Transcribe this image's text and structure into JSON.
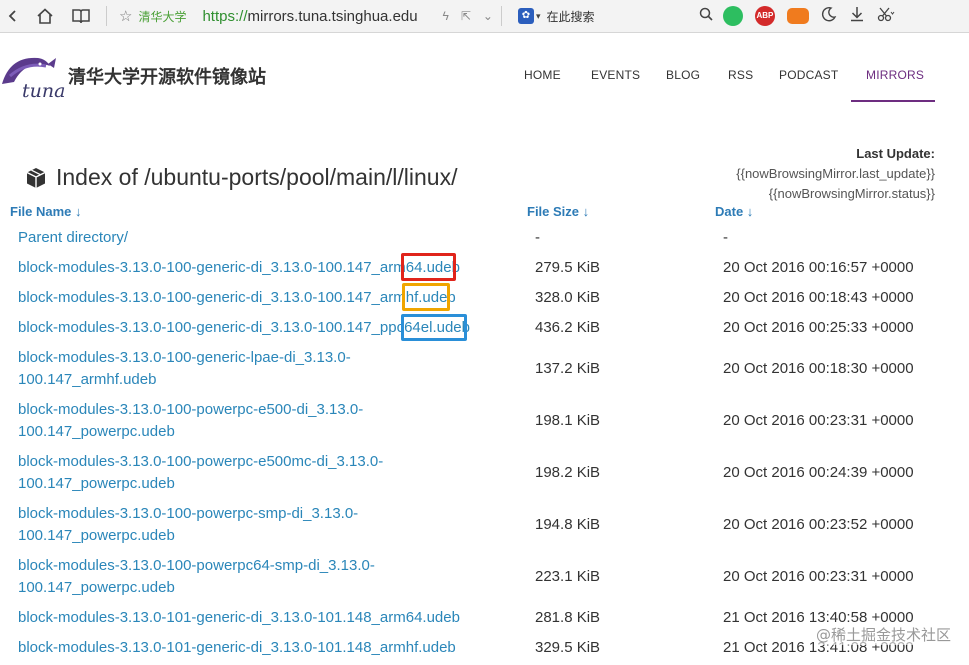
{
  "browser": {
    "site_badge": "清华大学",
    "url_proto": "https://",
    "url_rest": "mirrors.tuna.tsinghua.edu",
    "search_placeholder": "在此搜索",
    "abp_label": "ABP"
  },
  "site": {
    "title": "清华大学开源软件镜像站",
    "logo_text": "tuna",
    "nav": [
      {
        "label": "HOME"
      },
      {
        "label": "EVENTS"
      },
      {
        "label": "BLOG"
      },
      {
        "label": "RSS"
      },
      {
        "label": "PODCAST"
      },
      {
        "label": "MIRRORS",
        "active": true
      }
    ]
  },
  "status": {
    "label": "Last Update:",
    "last_update": "{{nowBrowsingMirror.last_update}}",
    "status": "{{nowBrowsingMirror.status}}"
  },
  "index": {
    "title": "Index of /ubuntu-ports/pool/main/l/linux/",
    "headers": {
      "name": "File Name ↓",
      "size": "File Size ↓",
      "date": "Date ↓"
    },
    "rows": [
      {
        "name": "Parent directory/",
        "size": "-",
        "date": "-"
      },
      {
        "name": "block-modules-3.13.0-100-generic-di_3.13.0-100.147_arm64.udeb",
        "size": "279.5 KiB",
        "date": "20 Oct 2016 00:16:57 +0000"
      },
      {
        "name": "block-modules-3.13.0-100-generic-di_3.13.0-100.147_armhf.udeb",
        "size": "328.0 KiB",
        "date": "20 Oct 2016 00:18:43 +0000"
      },
      {
        "name": "block-modules-3.13.0-100-generic-di_3.13.0-100.147_ppc64el.udeb",
        "size": "436.2 KiB",
        "date": "20 Oct 2016 00:25:33 +0000"
      },
      {
        "name": "block-modules-3.13.0-100-generic-lpae-di_3.13.0-100.147_armhf.udeb",
        "size": "137.2 KiB",
        "date": "20 Oct 2016 00:18:30 +0000"
      },
      {
        "name": "block-modules-3.13.0-100-powerpc-e500-di_3.13.0-100.147_powerpc.udeb",
        "size": "198.1 KiB",
        "date": "20 Oct 2016 00:23:31 +0000"
      },
      {
        "name": "block-modules-3.13.0-100-powerpc-e500mc-di_3.13.0-100.147_powerpc.udeb",
        "size": "198.2 KiB",
        "date": "20 Oct 2016 00:24:39 +0000"
      },
      {
        "name": "block-modules-3.13.0-100-powerpc-smp-di_3.13.0-100.147_powerpc.udeb",
        "size": "194.8 KiB",
        "date": "20 Oct 2016 00:23:52 +0000"
      },
      {
        "name": "block-modules-3.13.0-100-powerpc64-smp-di_3.13.0-100.147_powerpc.udeb",
        "size": "223.1 KiB",
        "date": "20 Oct 2016 00:23:31 +0000"
      },
      {
        "name": "block-modules-3.13.0-101-generic-di_3.13.0-101.148_arm64.udeb",
        "size": "281.8 KiB",
        "date": "21 Oct 2016 13:40:58 +0000"
      },
      {
        "name": "block-modules-3.13.0-101-generic-di_3.13.0-101.148_armhf.udeb",
        "size": "329.5 KiB",
        "date": "21 Oct 2016 13:41:08 +0000"
      }
    ]
  },
  "highlight_colors": {
    "arm64": "#e0241b",
    "armhf": "#f0a500",
    "ppc64el": "#2a8fd8"
  },
  "watermark": "@稀土掘金技术社区"
}
